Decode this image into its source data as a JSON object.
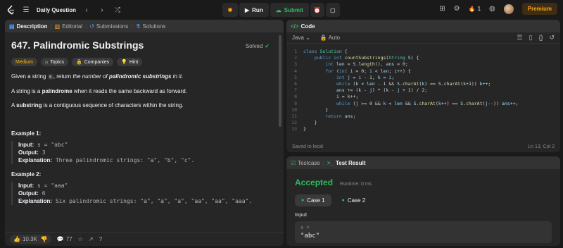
{
  "topbar": {
    "title": "Daily Question",
    "run_label": "Run",
    "submit_label": "Submit",
    "streak_count": "1",
    "premium_label": "Premium"
  },
  "left": {
    "tabs": [
      "Description",
      "Editorial",
      "Submissions",
      "Solutions"
    ],
    "title": "647. Palindromic Substrings",
    "solved_label": "Solved",
    "tags": [
      "Medium",
      "Topics",
      "Companies",
      "Hint"
    ],
    "para1_a": "Given a string ",
    "para1_code": "s",
    "para1_b": ", return ",
    "para1_c": "the number of ",
    "para1_d": "palindromic substrings",
    "para1_e": " in it.",
    "para2_a": "A string is a ",
    "para2_b": "palindrome",
    "para2_c": " when it reads the same backward as forward.",
    "para3_a": "A ",
    "para3_b": "substring",
    "para3_c": " is a contiguous sequence of characters within the string.",
    "examples": [
      {
        "title": "Example 1:",
        "input": "s = \"abc\"",
        "output": "3",
        "explanation": "Three palindromic strings: \"a\", \"b\", \"c\"."
      },
      {
        "title": "Example 2:",
        "input": "s = \"aaa\"",
        "output": "6",
        "explanation": "Six palindromic strings: \"a\", \"a\", \"a\", \"aa\", \"aa\", \"aaa\"."
      }
    ],
    "input_label": "Input:",
    "output_label": "Output:",
    "explanation_label": "Explanation:",
    "likes": "10.3K",
    "comments": "77"
  },
  "code": {
    "tab_label": "Code",
    "language": "Java",
    "mode": "Auto",
    "status_left": "Saved to local",
    "status_right": "Ln 13, Col 2"
  },
  "result": {
    "tabs": [
      "Testcase",
      "Test Result"
    ],
    "verdict": "Accepted",
    "runtime": "Runtime: 0 ms",
    "cases": [
      "Case 1",
      "Case 2"
    ],
    "input_label": "Input",
    "input_var": "s =",
    "input_value": "\"abc\""
  },
  "colors": {
    "accent": "#ffa116",
    "success": "#2cbb5d",
    "medium": "#ffb800"
  }
}
